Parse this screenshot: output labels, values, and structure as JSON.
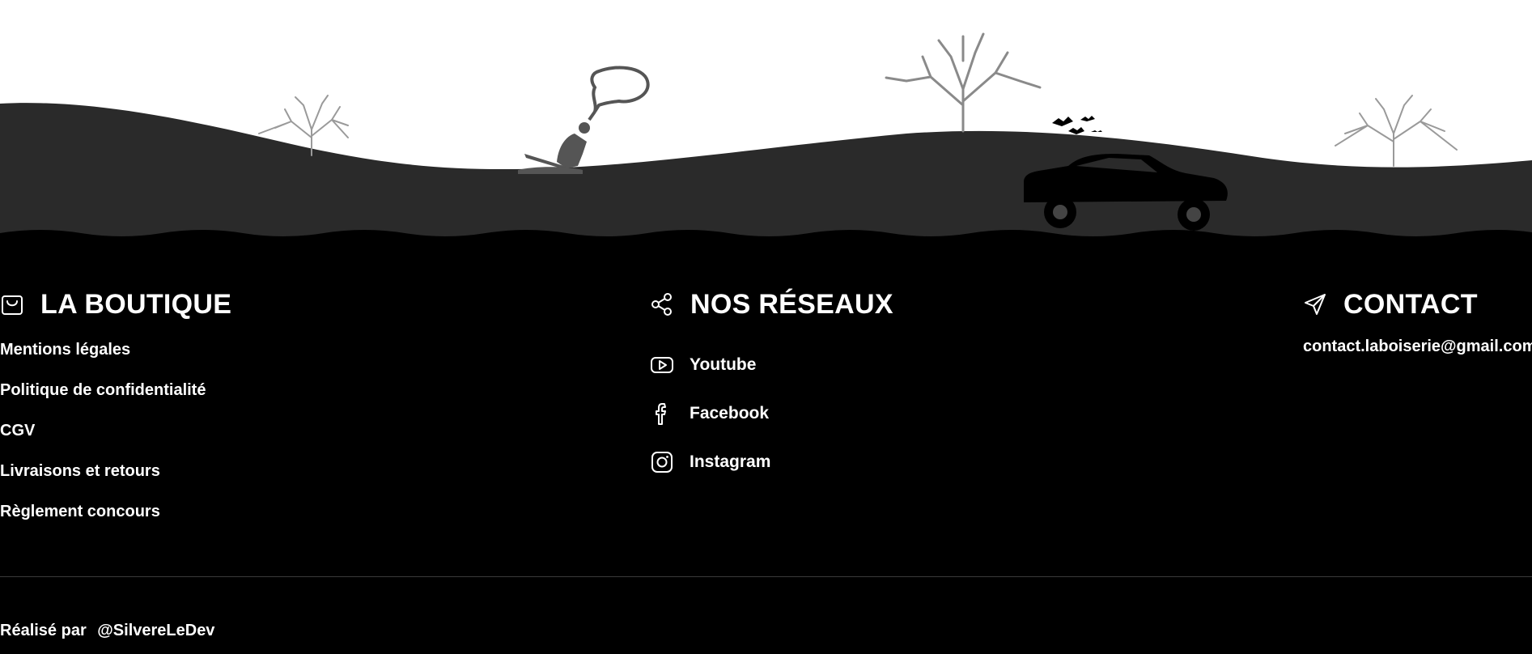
{
  "colors": {
    "background": "#000000",
    "hill": "#2a2a2a",
    "text": "#ffffff",
    "divider": "#3a3a3a"
  },
  "illustration": {
    "description_icons": [
      "tree-icon",
      "person-icon",
      "car-icon",
      "bird-icon",
      "thought-bubble-icon"
    ]
  },
  "boutique": {
    "icon": "shopping-bag-icon",
    "title": "LA BOUTIQUE",
    "links": [
      "Mentions légales",
      "Politique de confidentialité",
      "CGV",
      "Livraisons et retours",
      "Règlement concours"
    ]
  },
  "reseaux": {
    "icon": "share-icon",
    "title": "NOS RÉSEAUX",
    "items": [
      {
        "icon": "youtube-icon",
        "label": "Youtube"
      },
      {
        "icon": "facebook-icon",
        "label": "Facebook"
      },
      {
        "icon": "instagram-icon",
        "label": "Instagram"
      }
    ]
  },
  "contact": {
    "icon": "send-icon",
    "title": "CONTACT",
    "email": "contact.laboiserie@gmail.com"
  },
  "footer": {
    "credit_prefix": "Réalisé par",
    "credit_handle": "@SilvereLeDev"
  }
}
